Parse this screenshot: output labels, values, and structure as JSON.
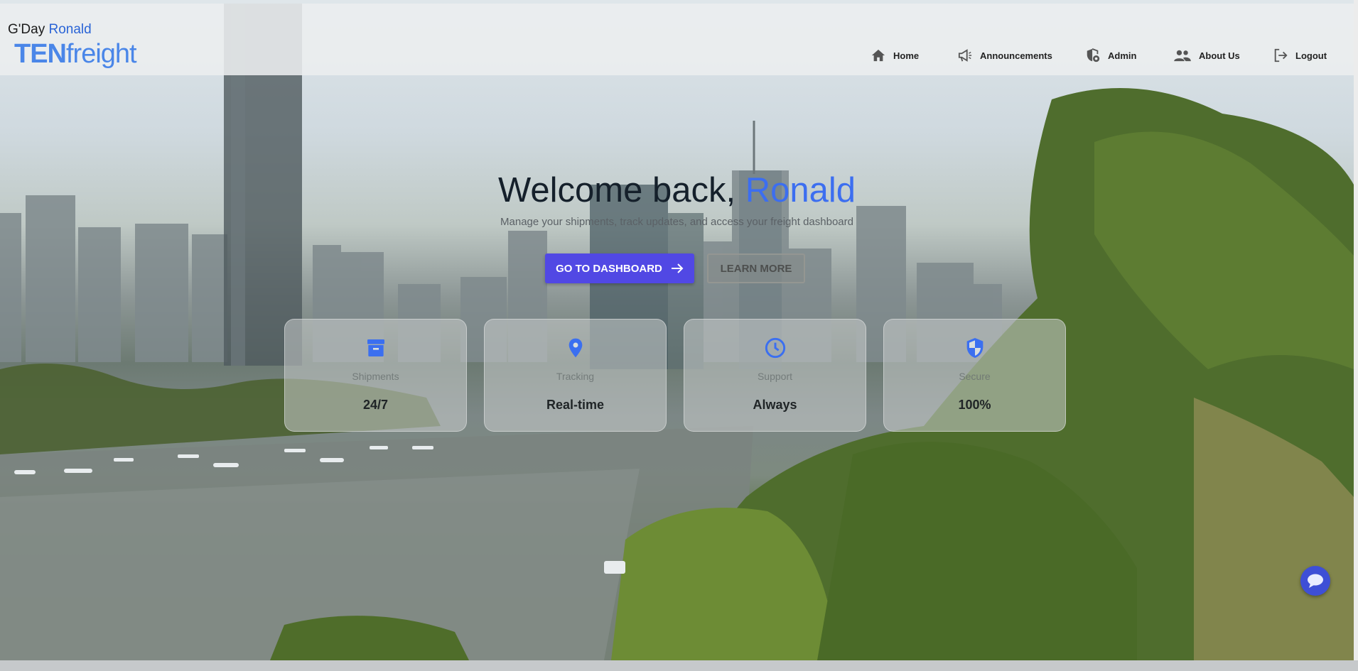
{
  "header": {
    "greeting": "G'Day",
    "user_name": "Ronald",
    "logo_ten": "TEN",
    "logo_freight": "freight"
  },
  "nav": [
    {
      "label": "Home",
      "icon": "home-icon"
    },
    {
      "label": "Announcements",
      "icon": "megaphone-icon"
    },
    {
      "label": "Admin",
      "icon": "admin-shield-icon"
    },
    {
      "label": "About Us",
      "icon": "people-icon"
    },
    {
      "label": "Logout",
      "icon": "logout-icon"
    }
  ],
  "hero": {
    "title_prefix": "Welcome back, ",
    "title_name": "Ronald",
    "subtitle": "Manage your shipments, track updates, and access your freight dashboard"
  },
  "buttons": {
    "primary": "GO TO DASHBOARD",
    "secondary": "LEARN MORE"
  },
  "stats": [
    {
      "label": "Shipments",
      "value": "24/7",
      "icon": "archive-box-icon"
    },
    {
      "label": "Tracking",
      "value": "Real-time",
      "icon": "location-pin-icon"
    },
    {
      "label": "Support",
      "value": "Always",
      "icon": "clock-icon"
    },
    {
      "label": "Secure",
      "value": "100%",
      "icon": "shield-icon"
    }
  ],
  "colors": {
    "accent_blue": "#3c6ef0",
    "primary_button": "#5148e4",
    "icon_blue": "#3b6ff0"
  },
  "chat": {
    "icon": "chat-bubble-icon"
  }
}
